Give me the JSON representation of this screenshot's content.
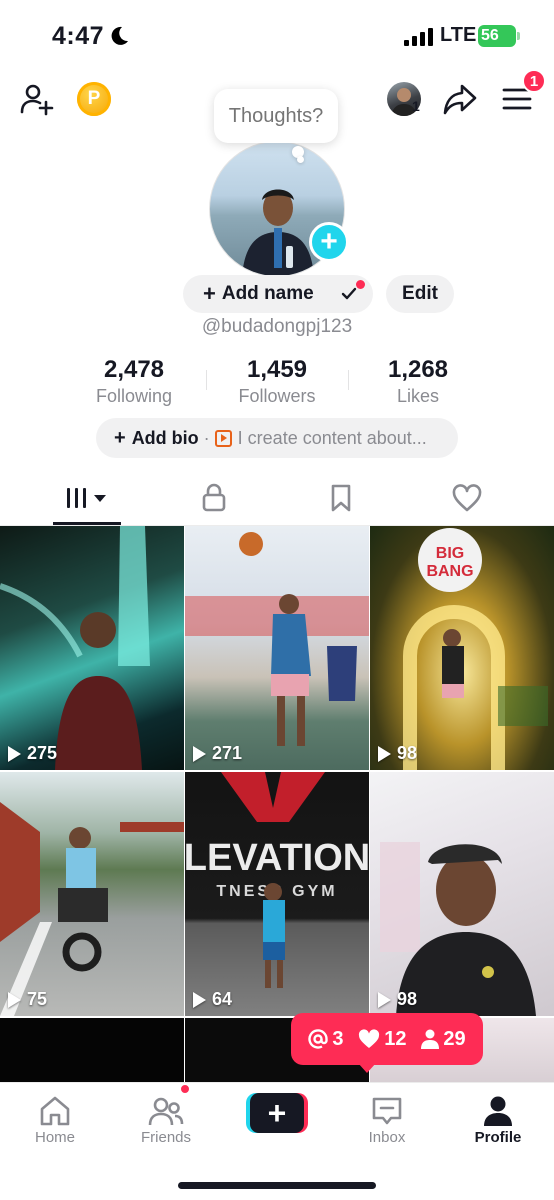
{
  "status_bar": {
    "time": "4:47",
    "network": "LTE",
    "battery": "56"
  },
  "header": {
    "coin_label": "P",
    "following_avatar_count": "1",
    "notification_count": "1"
  },
  "profile": {
    "bubble_text": "Thoughts?",
    "add_name_label": "Add name",
    "edit_label": "Edit",
    "username": "@budadongpj123",
    "stats": [
      {
        "value": "2,478",
        "label": "Following"
      },
      {
        "value": "1,459",
        "label": "Followers"
      },
      {
        "value": "1,268",
        "label": "Likes"
      }
    ],
    "bio": {
      "add_label": "Add bio",
      "separator": "·",
      "placeholder": "I create content about..."
    }
  },
  "tabs": [
    {
      "name": "videos",
      "icon": "grid-icon"
    },
    {
      "name": "private",
      "icon": "lock-icon"
    },
    {
      "name": "saved",
      "icon": "bookmark-icon"
    },
    {
      "name": "liked",
      "icon": "heart-icon"
    }
  ],
  "videos": [
    {
      "views": "275"
    },
    {
      "views": "271"
    },
    {
      "views": "98"
    },
    {
      "views": "75"
    },
    {
      "views": "64"
    },
    {
      "views": "98"
    }
  ],
  "activity_popup": {
    "mentions": "3",
    "likes": "12",
    "followers": "29"
  },
  "bottom_nav": {
    "home": "Home",
    "friends": "Friends",
    "inbox": "Inbox",
    "profile": "Profile"
  },
  "colors": {
    "accent_red": "#fe2c55",
    "accent_cyan": "#20d5ec",
    "text_primary": "#161823",
    "text_secondary": "#8a8b91"
  }
}
